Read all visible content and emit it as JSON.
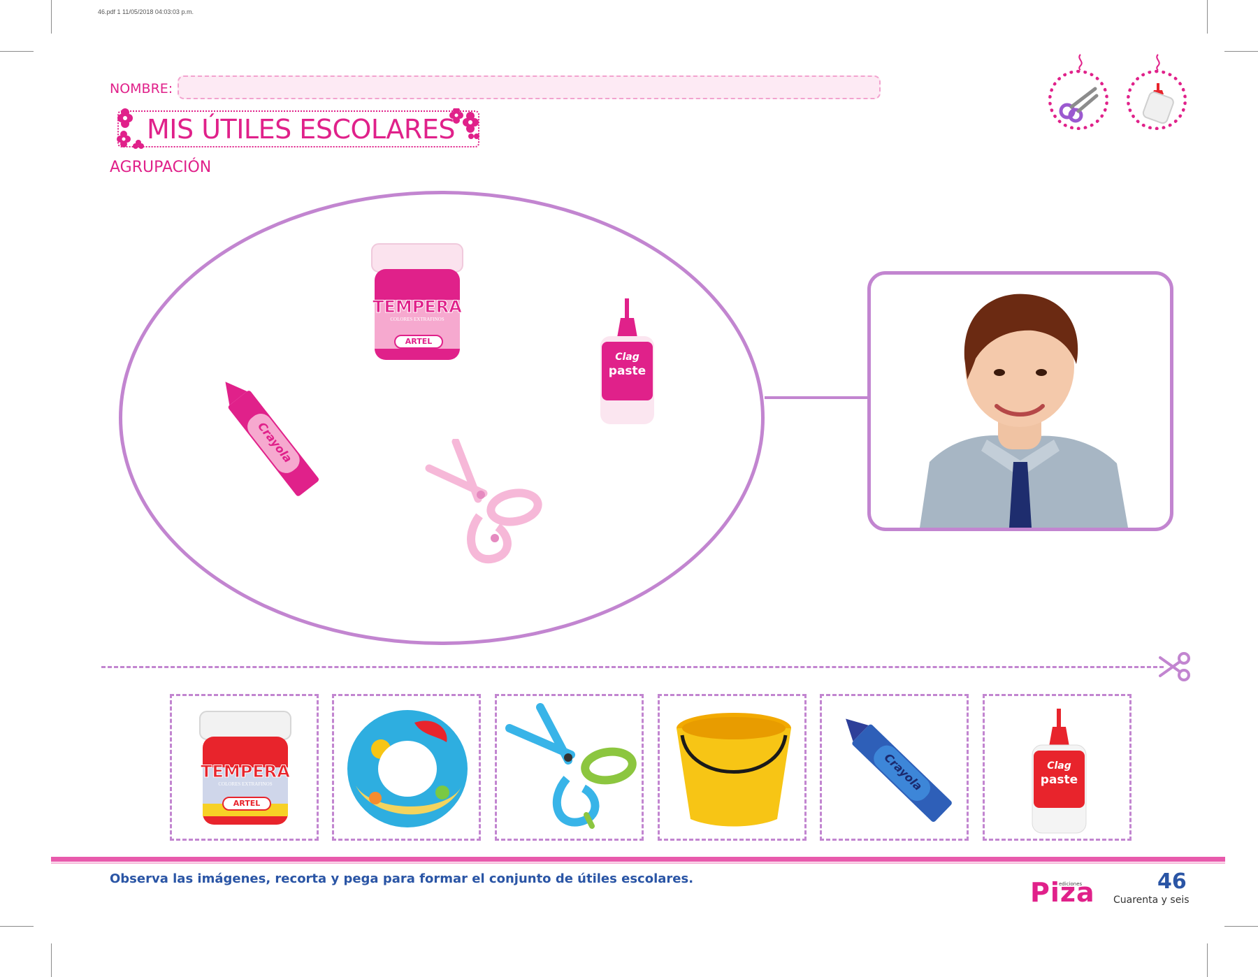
{
  "meta": {
    "file_info": "46.pdf   1   11/05/2018   04:03:03 p.m."
  },
  "header": {
    "name_label": "NOMBRE:",
    "title": "MIS ÚTILES ESCOLARES",
    "subtitle": "AGRUPACIÓN"
  },
  "icons": [
    "scissors-icon",
    "glue-icon"
  ],
  "set_items": [
    {
      "name": "tempera-jar",
      "label": "TEMPERA",
      "sub": "COLORES EXTRAFINOS",
      "brand": "ARTEL",
      "color": "#e0218a"
    },
    {
      "name": "glue-bottle",
      "brand": "Clag",
      "label": "paste",
      "color": "#e0218a"
    },
    {
      "name": "crayon",
      "label": "Crayola",
      "color": "#e0218a"
    },
    {
      "name": "scissors",
      "color": "#f6b8d8"
    }
  ],
  "cutouts": [
    {
      "name": "tempera-jar",
      "label": "TEMPERA",
      "sub": "COLORES EXTRAFINOS",
      "brand": "ARTEL",
      "color": "#e8242c"
    },
    {
      "name": "swim-ring",
      "label": "",
      "color": "#2eaee0"
    },
    {
      "name": "scissors",
      "label": "",
      "color": "#38b4e8"
    },
    {
      "name": "bucket",
      "label": "",
      "color": "#f7c515"
    },
    {
      "name": "crayon",
      "label": "Crayola",
      "color": "#2e5fb8"
    },
    {
      "name": "glue-bottle",
      "brand": "Clag",
      "label": "paste",
      "color": "#e8242c"
    }
  ],
  "footer": {
    "instruction": "Observa las imágenes, recorta y pega para formar el conjunto de útiles escolares.",
    "publisher_small": "ediciones",
    "publisher": "Piza",
    "page_number": "46",
    "page_words": "Cuarenta y seis"
  },
  "colors": {
    "accent": "#e0218a",
    "frame": "#c285d0",
    "text_blue": "#2a55a5"
  }
}
